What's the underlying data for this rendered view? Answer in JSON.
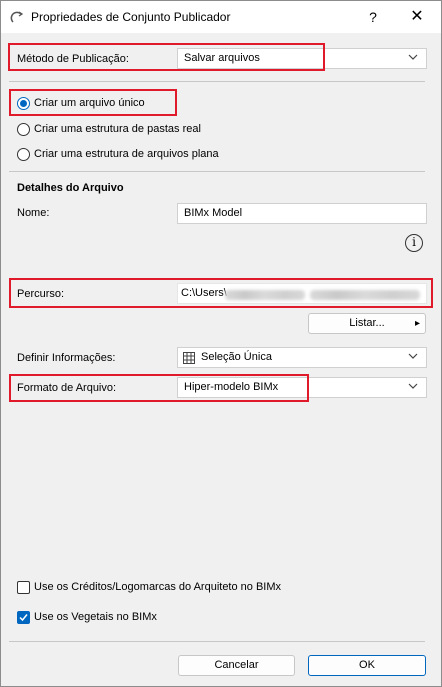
{
  "window": {
    "title": "Propriedades de Conjunto Publicador",
    "help": "?",
    "close": "✕"
  },
  "publish_method": {
    "label": "Método de Publicação:",
    "value": "Salvar arquivos"
  },
  "options": [
    {
      "label": "Criar um arquivo único",
      "selected": true
    },
    {
      "label": "Criar uma estrutura de pastas real",
      "selected": false
    },
    {
      "label": "Criar uma estrutura de arquivos plana",
      "selected": false
    }
  ],
  "details": {
    "heading": "Detalhes do Arquivo",
    "name_label": "Nome:",
    "name_value": "BIMx Model",
    "info_glyph": "i"
  },
  "path": {
    "label": "Percurso:",
    "value": "C:\\Users\\"
  },
  "list_button": {
    "label": "Listar...",
    "arrow": "▸"
  },
  "define_info": {
    "label": "Definir Informações:",
    "value": "Seleção Única"
  },
  "file_format": {
    "label": "Formato de Arquivo:",
    "value": "Hiper-modelo BIMx"
  },
  "checks": [
    {
      "label": "Use os Créditos/Logomarcas do Arquiteto no BIMx",
      "checked": false
    },
    {
      "label": "Use os Vegetais no BIMx",
      "checked": true
    }
  ],
  "buttons": {
    "cancel": "Cancelar",
    "ok": "OK"
  },
  "colors": {
    "highlight": "#e0192b",
    "accent": "#0067c0"
  }
}
